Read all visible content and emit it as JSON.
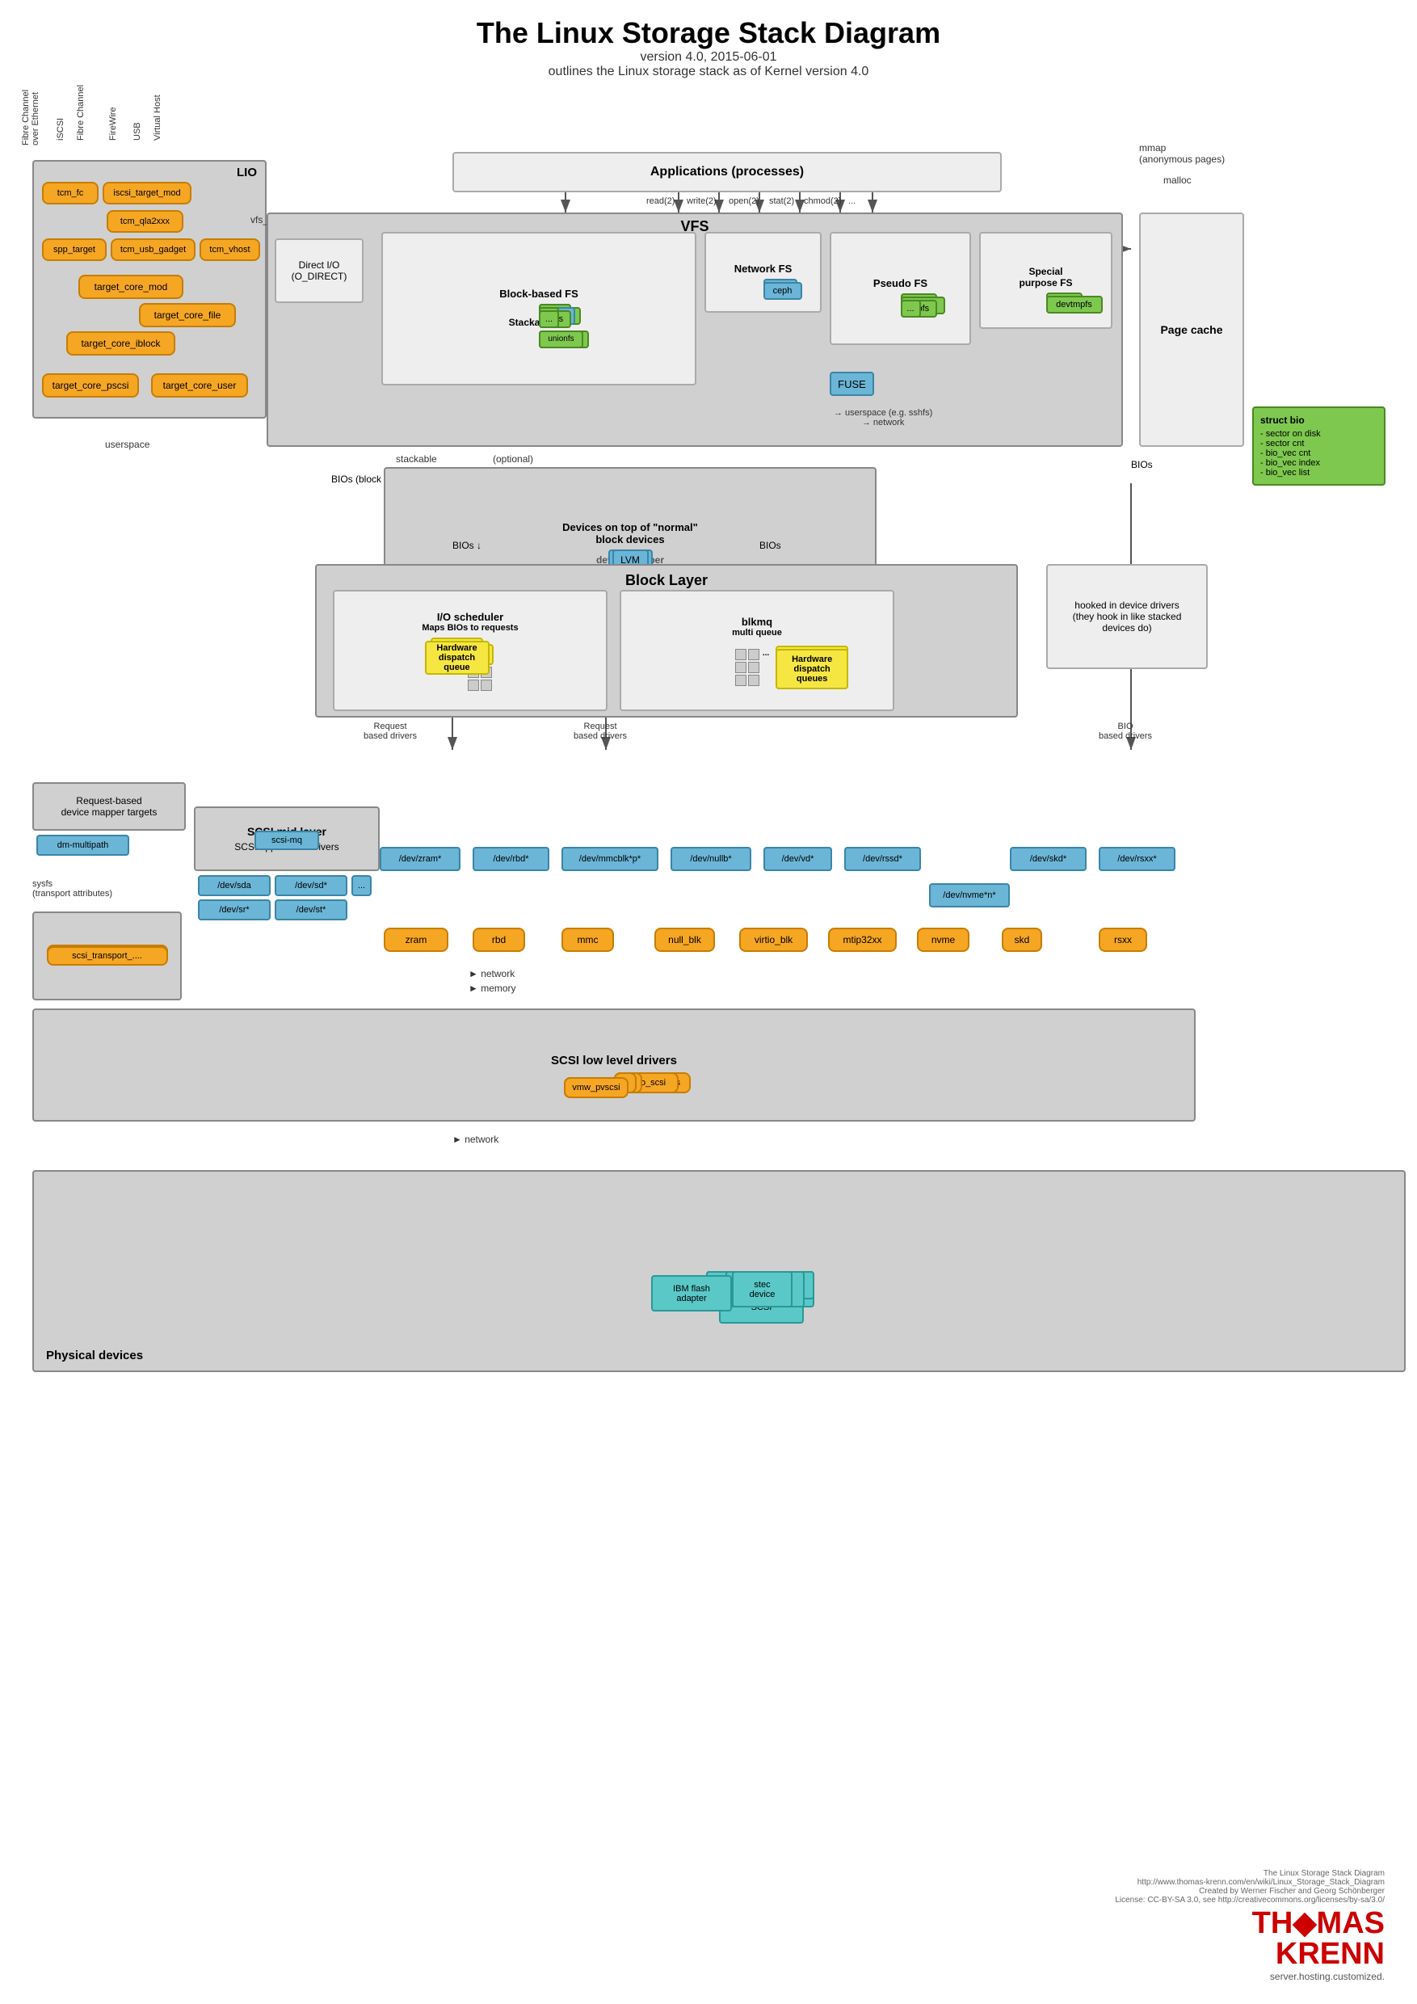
{
  "title": "The Linux Storage Stack Diagram",
  "version": "version 4.0, 2015-06-01",
  "description": "outlines the Linux storage stack as of Kernel version 4.0",
  "footer": {
    "line1": "The Linux Storage Stack Diagram",
    "line2": "http://www.thomas-krenn.com/en/wiki/Linux_Storage_Stack_Diagram",
    "line3": "Created by Werner Fischer and Georg Schönberger",
    "line4": "License: CC-BY-SA 3.0, see http://creativecommons.org/licenses/by-sa/3.0/",
    "logo": "THOMAS KRENN",
    "tagline": "server.hosting.customized."
  },
  "components": {
    "applications": "Applications (processes)",
    "vfs": "VFS",
    "page_cache": "Page cache",
    "block_layer": "Block Layer",
    "lio": "LIO",
    "physical_devices": "Physical devices"
  }
}
